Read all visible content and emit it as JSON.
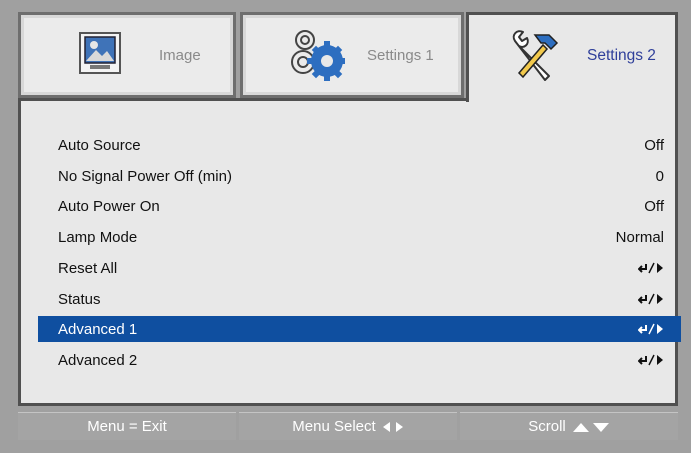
{
  "tabs": [
    {
      "label": "Image",
      "icon": "image-icon",
      "active": false
    },
    {
      "label": "Settings 1",
      "icon": "gears-icon",
      "active": false
    },
    {
      "label": "Settings 2",
      "icon": "tools-icon",
      "active": true
    }
  ],
  "menu": {
    "items": [
      {
        "label": "Auto Source",
        "value": "Off"
      },
      {
        "label": "No Signal Power Off (min)",
        "value": "0"
      },
      {
        "label": "Auto Power On",
        "value": "Off"
      },
      {
        "label": "Lamp Mode",
        "value": "Normal"
      },
      {
        "label": "Reset All",
        "value": "enter-arrow-icon"
      },
      {
        "label": "Status",
        "value": "enter-arrow-icon"
      },
      {
        "label": "Advanced 1",
        "value": "enter-arrow-icon",
        "selected": true
      },
      {
        "label": "Advanced 2",
        "value": "enter-arrow-icon"
      }
    ]
  },
  "footer": {
    "exit_label": "Menu = Exit",
    "select_label": "Menu Select",
    "scroll_label": "Scroll"
  },
  "colors": {
    "selected_row": "#0f4fa0",
    "active_tab_text": "#2f3f9a",
    "inactive_tab_text": "#8a8a8a",
    "background": "#a0a0a0"
  }
}
